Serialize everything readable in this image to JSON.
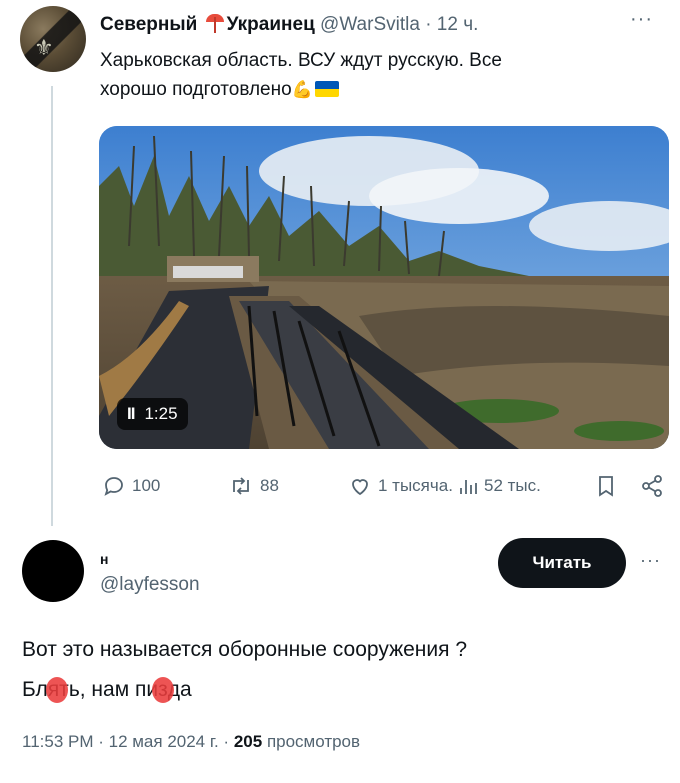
{
  "tweet": {
    "author_name_part1": "Северный",
    "author_name_part2": "Украинец",
    "handle": "@WarSvitla",
    "time": "· 12 ч.",
    "more": "···",
    "text_line1": "Харьковская область. ВСУ ждут русскую. Все",
    "text_line2": "хорошо подготовлено",
    "video_duration": "1:25",
    "pause_glyph": "II",
    "actions": {
      "replies": "100",
      "reposts": "88",
      "likes": "1 тысяча.",
      "views": "52 тыс."
    }
  },
  "reply": {
    "author_name": "н",
    "handle": "@layfesson",
    "follow_label": "Читать",
    "more": "···",
    "text_line1": "Вот это называется оборонные сооружения ?",
    "line2_part1": "Бл",
    "line2_redacted1": "ят",
    "line2_part2": "ь, нам пи",
    "line2_redacted2": "з",
    "line2_part3": "да",
    "meta_time": "11:53 PM · 12 мая 2024 г. ·",
    "meta_views_count": "205",
    "meta_views_label": "просмотров"
  },
  "icons": {
    "reply": "reply-icon",
    "repost": "repost-icon",
    "like": "heart-icon",
    "views": "views-icon",
    "bookmark": "bookmark-icon",
    "share": "share-icon"
  },
  "colors": {
    "text": "#0f1419",
    "secondary": "#536471",
    "thread_line": "#cfd9de",
    "follow_button": "#0f1419",
    "redaction": "#eb3c3c"
  }
}
